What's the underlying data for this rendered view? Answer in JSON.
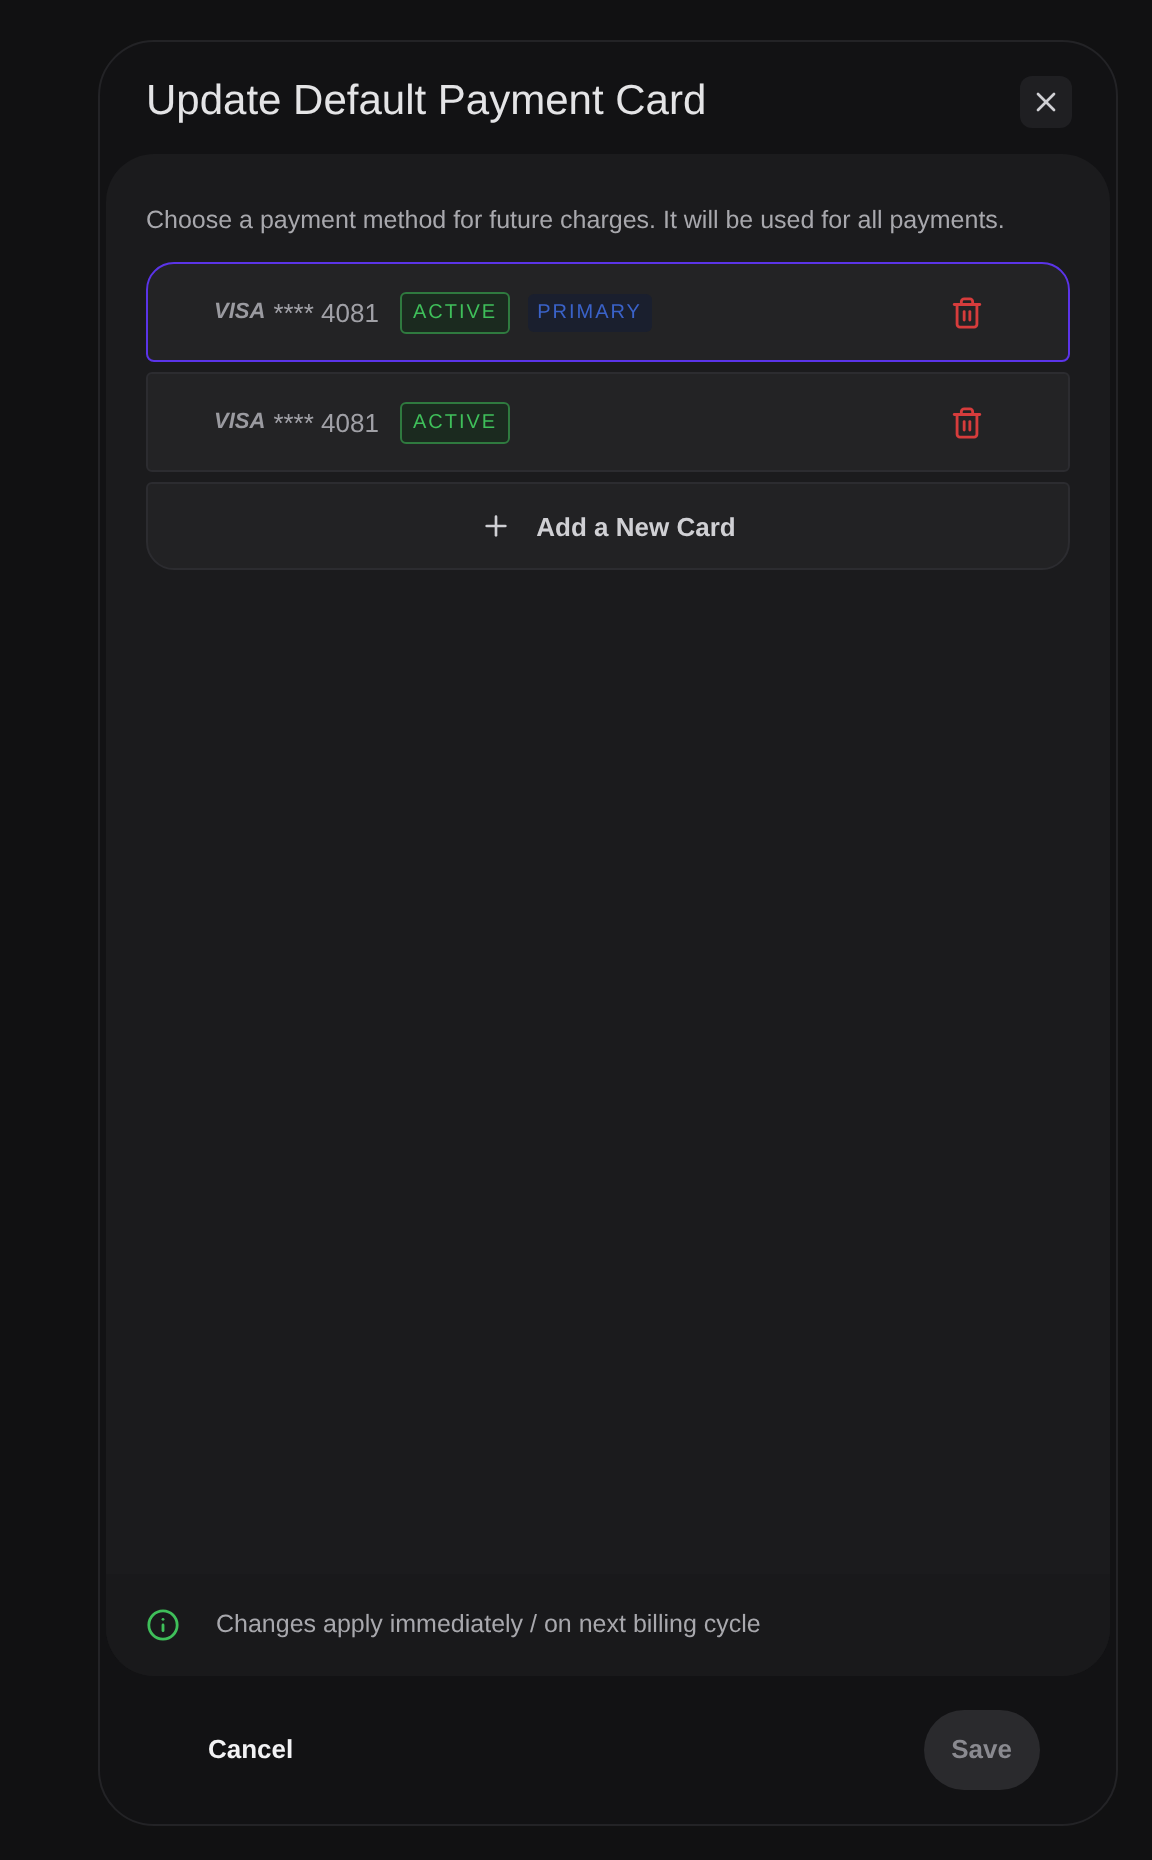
{
  "dialog": {
    "title": "Update Default Payment Card",
    "description": "Choose a payment method for future charges. It will be used for all payments.",
    "cards": [
      {
        "brand": "VISA",
        "number": "**** 4081",
        "selected": true,
        "badges": [
          {
            "kind": "active",
            "label": "ACTIVE"
          },
          {
            "kind": "primary",
            "label": "PRIMARY"
          }
        ]
      },
      {
        "brand": "VISA",
        "number": "**** 4081",
        "selected": false,
        "badges": [
          {
            "kind": "active",
            "label": "ACTIVE"
          }
        ]
      }
    ],
    "add_card": "Add a New Card",
    "note": "Changes apply immediately / on next billing cycle",
    "buttons": [
      {
        "kind": "cancel",
        "label": "Cancel",
        "disabled": false
      },
      {
        "kind": "save",
        "label": "Save",
        "disabled": true
      }
    ]
  }
}
